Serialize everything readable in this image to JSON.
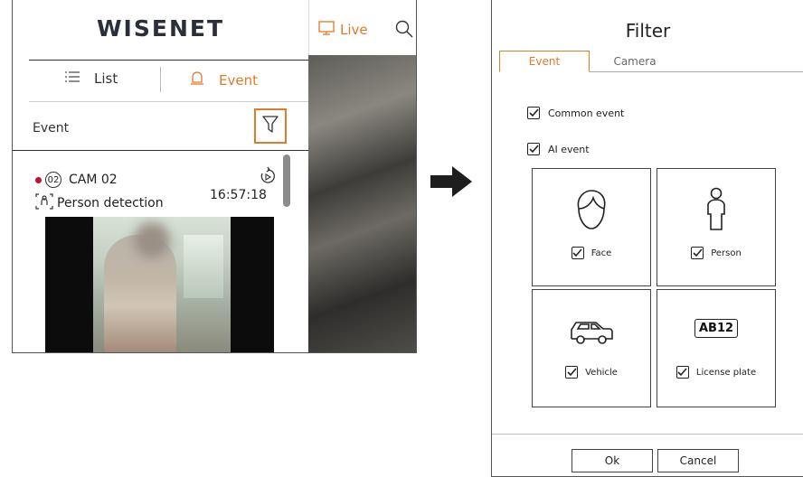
{
  "phone": {
    "logo": "WISENET",
    "tabs": {
      "list": "List",
      "event": "Event"
    },
    "live_label": "Live",
    "section_label": "Event",
    "event": {
      "cam_number": "02",
      "cam_name": "CAM 02",
      "type": "Person detection",
      "time": "16:57:18"
    }
  },
  "dialog": {
    "title": "Filter",
    "tabs": {
      "event": "Event",
      "camera": "Camera"
    },
    "common_event": "Common event",
    "ai_event": "AI event",
    "cards": {
      "face": "Face",
      "person": "Person",
      "vehicle": "Vehicle",
      "license_plate": "License plate",
      "plate_text": "AB12"
    },
    "ok": "Ok",
    "cancel": "Cancel"
  },
  "colors": {
    "accent": "#e07a2c",
    "record_dot": "#c8102e"
  },
  "icons": [
    "list-icon",
    "bell-icon",
    "monitor-icon",
    "search-icon",
    "filter-icon",
    "replay-icon",
    "person-detect-icon",
    "arrow-right-icon",
    "face-icon",
    "person-icon",
    "car-icon",
    "license-plate-icon",
    "checkbox-checked-icon"
  ]
}
